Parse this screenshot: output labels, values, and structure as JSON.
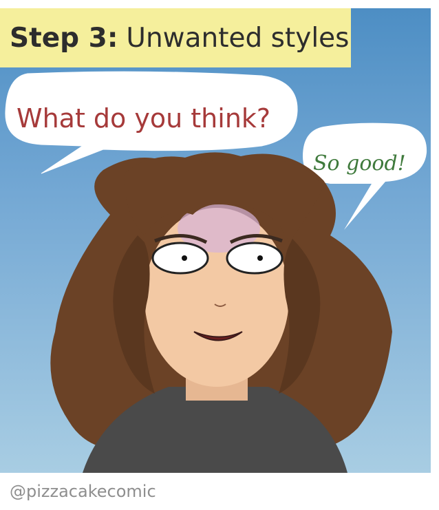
{
  "caption": {
    "step": "Step 3:",
    "title": "Unwanted styles"
  },
  "bubbles": [
    {
      "text": "What do you think?",
      "color": "#a63a3a"
    },
    {
      "text": "So good!",
      "color": "#3f7a3c"
    }
  ],
  "footer": {
    "handle": "@pizzacakecomic"
  },
  "colors": {
    "caption_bg": "#f5ef9c",
    "sky_top": "#4d8ec4",
    "sky_bottom": "#a8cde3",
    "hair": "#6b4226",
    "skin": "#f3c9a4",
    "shirt": "#4a4a4a"
  }
}
